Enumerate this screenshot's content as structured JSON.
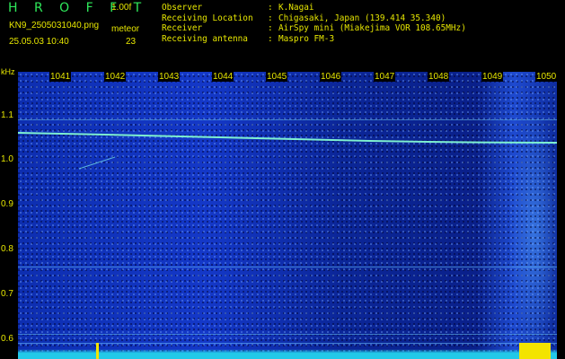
{
  "header": {
    "app_name": "H R O F F T",
    "version": "1.00f",
    "filename": "KN9_2505031040.png",
    "datetime": "25.05.03 10:40",
    "meteor_label": "meteor",
    "meteor_count": "23"
  },
  "metadata": [
    {
      "key": "Observer",
      "value": "K.Nagai"
    },
    {
      "key": "Receiving Location",
      "value": "Chigasaki, Japan (139.414 35.340)"
    },
    {
      "key": "Receiver",
      "value": "AirSpy mini (Miakejima VOR 108.65MHz)"
    },
    {
      "key": "Receiving antenna",
      "value": "Maspro FM-3"
    }
  ],
  "axes": {
    "y_unit": "kHz",
    "y_labels": [
      "1.1",
      "1.0",
      "0.9",
      "0.8",
      "0.7",
      "0.6"
    ],
    "x_labels": [
      "1041",
      "1042",
      "1043",
      "1044",
      "1045",
      "1046",
      "1047",
      "1048",
      "1049",
      "1050"
    ]
  },
  "colors": {
    "label": "#e6e600",
    "title": "#2ee85a",
    "background": "#000000",
    "spectrogram": "#1438c8",
    "signal": "#7ef0d0"
  }
}
